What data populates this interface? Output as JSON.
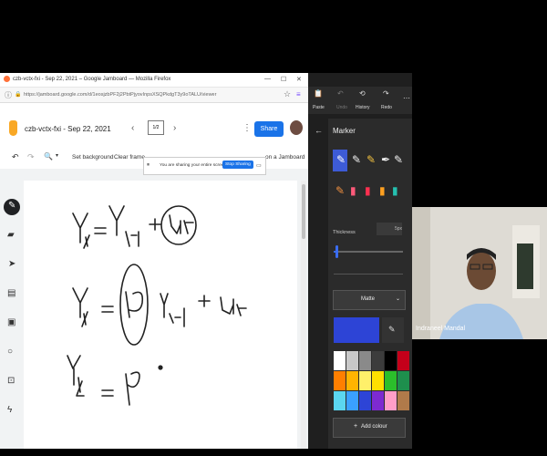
{
  "firefox": {
    "window_title": "czb-vctx-fxi - Sep 22, 2021 – Google Jamboard — Mozilla Firefox",
    "url": "https://jamboard.google.com/d/1eosjzbPF2j2PbtPjyovInpsXSQPkdgT3y9oTALU/viewer"
  },
  "jamboard": {
    "title": "czb-vctx-fxi - Sep 22, 2021",
    "frame_indicator": "1/2",
    "share_label": "Share",
    "set_background": "Set background",
    "clear_frame": "Clear frame",
    "open_label": "on a Jamboard"
  },
  "sharing_banner": {
    "message": "You are sharing your entire screen.",
    "stop_label": "Stop Sharing"
  },
  "whiteboard": {
    "toolbar": [
      "Paste",
      "Undo",
      "History",
      "Redo"
    ],
    "panel_title": "Marker",
    "thickness_label": "Thickness",
    "thickness_value": "5px",
    "style_select": "Matte",
    "add_colour_label": "Add colour",
    "colors": [
      "#ffffff",
      "#c8c8c8",
      "#8a8a8a",
      "#3c3c3c",
      "#000000",
      "#c4001a",
      "#ff7f00",
      "#ffb400",
      "#fff06a",
      "#ffe000",
      "#2bbf2b",
      "#1e8f4d",
      "#5bd6f0",
      "#3aa0ff",
      "#2d44d6",
      "#7d2ad0",
      "#ff9ec8",
      "#b07a4a"
    ],
    "current_color": "#2d44d6"
  },
  "video": {
    "participant_name": "Indraneel Mandal"
  }
}
